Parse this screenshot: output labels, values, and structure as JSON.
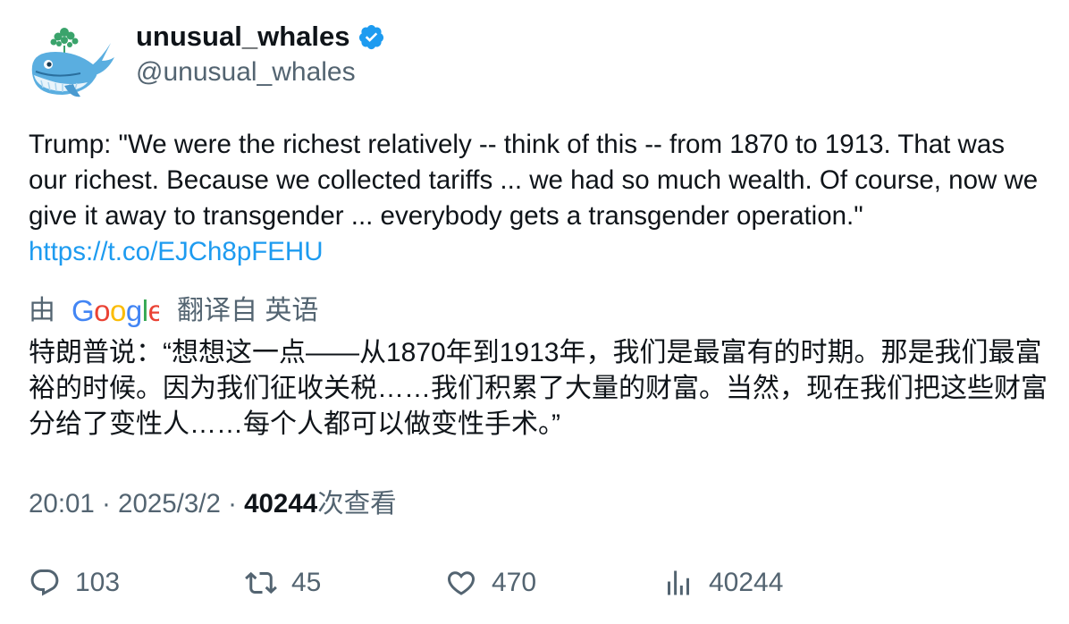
{
  "author": {
    "display_name": "unusual_whales",
    "handle": "@unusual_whales",
    "verified": true,
    "avatar_icon": "whale-icon"
  },
  "tweet": {
    "text": "Trump: \"We were the richest relatively -- think of this -- from 1870 to 1913. That was our richest. Because we collected tariffs ... we had so much wealth. Of course, now we give it away to transgender ... everybody gets a transgender operation.\" ",
    "link": "https://t.co/EJCh8pFEHU"
  },
  "translation": {
    "prefix": "由",
    "provider": "Google",
    "suffix": "翻译自 英语",
    "text": "特朗普说：“想想这一点——从1870年到1913年，我们是最富有的时期。那是我们最富裕的时候。因为我们征收关税……我们积累了大量的财富。当然，现在我们把这些财富分给了变性人……每个人都可以做变性手术。”"
  },
  "meta": {
    "time": "20:01",
    "sep1": " · ",
    "date": "2025/3/2",
    "sep2": " · ",
    "views_count": "40244",
    "views_label": "次查看"
  },
  "actions": {
    "replies": "103",
    "retweets": "45",
    "likes": "470",
    "views": "40244"
  },
  "colors": {
    "link": "#1d9bf0",
    "secondary_text": "#536471",
    "primary_text": "#0f1419",
    "verified_badge": "#1d9bf0"
  }
}
